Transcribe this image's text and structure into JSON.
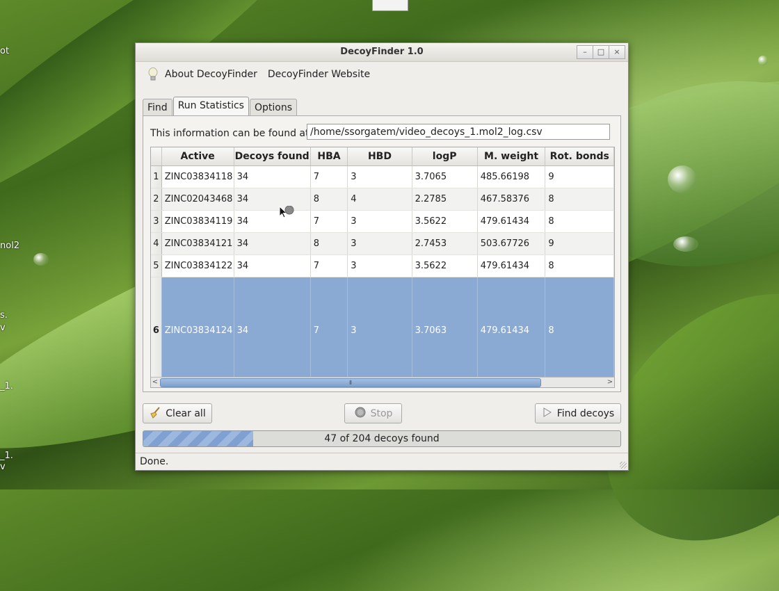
{
  "desktop": {
    "labels": [
      "ot",
      "nol2",
      "s.",
      "v",
      "_1.",
      "_1.",
      "v"
    ]
  },
  "window": {
    "title": "DecoyFinder 1.0",
    "controls": [
      "–",
      "□",
      "×"
    ]
  },
  "menu": {
    "about": "About DecoyFinder",
    "website": "DecoyFinder Website"
  },
  "tabs": [
    {
      "label": "Find",
      "active": false
    },
    {
      "label": "Run Statistics",
      "active": true
    },
    {
      "label": "Options",
      "active": false
    }
  ],
  "info": {
    "label": "This information can be found at",
    "path": "/home/ssorgatem/video_decoys_1.mol2_log.csv"
  },
  "table": {
    "columns": [
      "Active",
      "Decoys found",
      "HBA",
      "HBD",
      "logP",
      "M. weight",
      "Rot. bonds"
    ],
    "rows": [
      {
        "num": "1",
        "cells": [
          "ZINC03834118",
          "34",
          "7",
          "3",
          "3.7065",
          "485.66198",
          "9"
        ]
      },
      {
        "num": "2",
        "cells": [
          "ZINC02043468",
          "34",
          "8",
          "4",
          "2.2785",
          "467.58376",
          "8"
        ]
      },
      {
        "num": "3",
        "cells": [
          "ZINC03834119",
          "34",
          "7",
          "3",
          "3.5622",
          "479.61434",
          "8"
        ]
      },
      {
        "num": "4",
        "cells": [
          "ZINC03834121",
          "34",
          "8",
          "3",
          "2.7453",
          "503.67726",
          "9"
        ]
      },
      {
        "num": "5",
        "cells": [
          "ZINC03834122",
          "34",
          "7",
          "3",
          "3.5622",
          "479.61434",
          "8"
        ]
      },
      {
        "num": "6",
        "cells": [
          "ZINC03834124",
          "34",
          "7",
          "3",
          "3.7063",
          "479.61434",
          "8"
        ]
      }
    ],
    "selected_row": 6,
    "scroll_arrows": [
      "<",
      ">"
    ],
    "scroll_grip": "⦀"
  },
  "buttons": {
    "clear": "Clear all",
    "stop": "Stop",
    "find": "Find decoys"
  },
  "progress": {
    "text": "47 of 204 decoys found",
    "fraction": 0.2304
  },
  "status": {
    "text": "Done."
  },
  "colors": {
    "selection": "#8aa9d3",
    "progress": "#7fa0d0"
  }
}
